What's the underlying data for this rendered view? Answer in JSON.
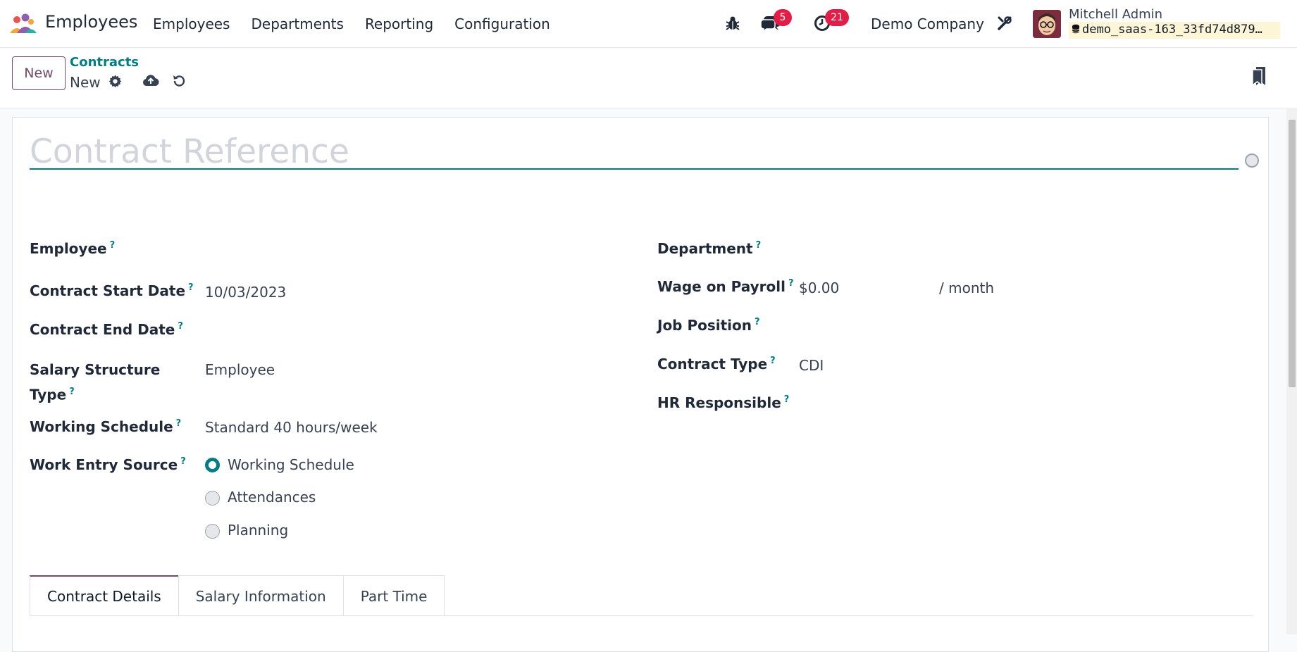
{
  "navbar": {
    "app_name": "Employees",
    "menu": [
      "Employees",
      "Departments",
      "Reporting",
      "Configuration"
    ],
    "messages_count": "5",
    "activities_count": "21",
    "company": "Demo Company",
    "user_name": "Mitchell Admin",
    "db_name": "demo_saas-163_33fd74d879…"
  },
  "control": {
    "new_label": "New",
    "breadcrumb": "Contracts",
    "record_name": "New"
  },
  "form": {
    "reference_placeholder": "Contract Reference",
    "left": {
      "employee_label": "Employee",
      "start_date_label": "Contract Start Date",
      "start_date_value": "10/03/2023",
      "end_date_label": "Contract End Date",
      "salary_type_label_1": "Salary Structure",
      "salary_type_label_2": "Type",
      "salary_type_value": "Employee",
      "schedule_label": "Working Schedule",
      "schedule_value": "Standard 40 hours/week",
      "work_entry_label": "Work Entry Source",
      "work_entry_options": [
        "Working Schedule",
        "Attendances",
        "Planning"
      ],
      "work_entry_selected": "Working Schedule"
    },
    "right": {
      "department_label": "Department",
      "wage_label": "Wage on Payroll",
      "wage_value": "$0.00",
      "wage_unit": "/ month",
      "job_label": "Job Position",
      "contract_type_label": "Contract Type",
      "contract_type_value": "CDI",
      "hr_label": "HR Responsible"
    },
    "help_mark": "?",
    "tabs": [
      "Contract Details",
      "Salary Information",
      "Part Time"
    ]
  },
  "colors": {
    "brand": "#714b67",
    "accent": "#017e84",
    "badge": "#e11d48"
  }
}
